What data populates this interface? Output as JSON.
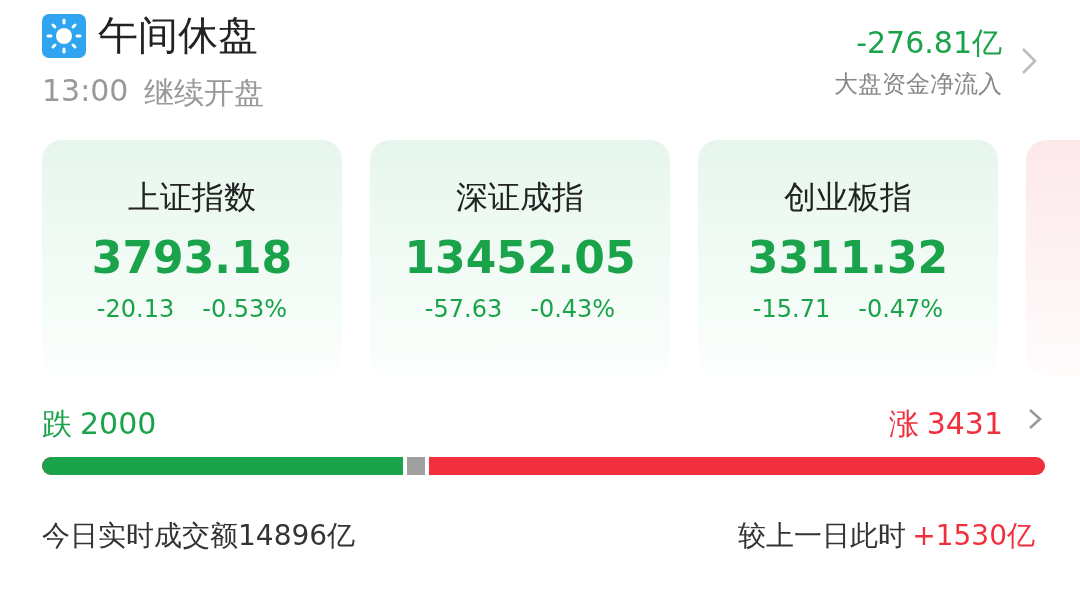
{
  "header": {
    "title": "午间休盘",
    "time": "13:00",
    "subtitle": "继续开盘",
    "flow_value": "-276.81亿",
    "flow_label": "大盘资金净流入"
  },
  "indices": [
    {
      "kind": "down",
      "name": "上证指数",
      "value": "3793.18",
      "change": "-20.13",
      "percent": "-0.53%"
    },
    {
      "kind": "down",
      "name": "深证成指",
      "value": "13452.05",
      "change": "-57.63",
      "percent": "-0.43%"
    },
    {
      "kind": "down",
      "name": "创业板指",
      "value": "3311.32",
      "change": "-15.71",
      "percent": "-0.47%"
    },
    {
      "kind": "up"
    }
  ],
  "breadth": {
    "fall_label": "跌",
    "fall_count": "2000",
    "rise_label": "涨",
    "rise_count": "3431",
    "level": 0.36
  },
  "turnover": {
    "label": "今日实时成交额14896亿",
    "compare_label": "较上一日此时",
    "compare_value": "+1530亿"
  }
}
